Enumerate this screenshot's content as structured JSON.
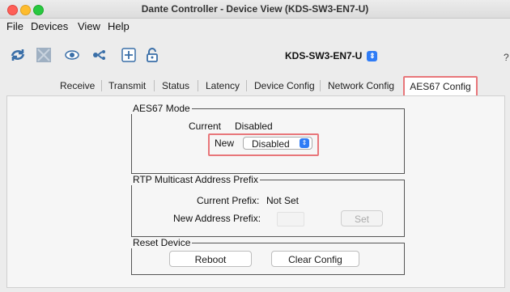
{
  "window": {
    "title": "Dante Controller - Device View (KDS-SW3-EN7-U)"
  },
  "menu": [
    "File",
    "Devices",
    "View",
    "Help"
  ],
  "toolbar": {
    "icons": [
      "rescan-icon",
      "lock-grid-icon",
      "eye-icon",
      "network-icon",
      "add-icon",
      "unlock-icon"
    ],
    "device": "KDS-SW3-EN7-U",
    "help": "?"
  },
  "tabs": [
    "Receive",
    "Transmit",
    "Status",
    "Latency",
    "Device Config",
    "Network Config",
    "AES67 Config"
  ],
  "aes67": {
    "legend": "AES67 Mode",
    "current_label": "Current",
    "current_value": "Disabled",
    "new_label": "New",
    "new_value": "Disabled"
  },
  "rtp": {
    "legend": "RTP Multicast Address Prefix",
    "current_label": "Current Prefix:",
    "current_value": "Not Set",
    "new_label": "New Address Prefix:",
    "set_label": "Set"
  },
  "reset": {
    "legend": "Reset Device",
    "reboot_label": "Reboot",
    "clear_label": "Clear Config"
  },
  "colors": {
    "highlight": "#e8767a",
    "accent": "#2f7cf6"
  }
}
